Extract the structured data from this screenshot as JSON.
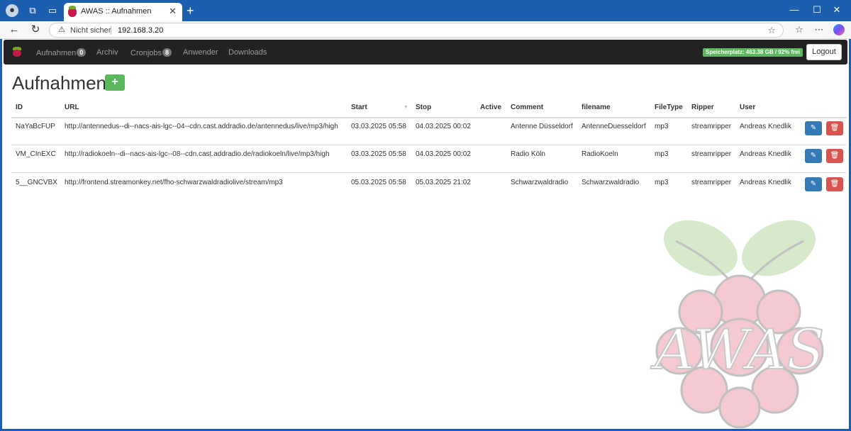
{
  "browser": {
    "tab_title": "AWAS :: Aufnahmen",
    "tab_close": "✕",
    "new_tab": "+",
    "security_label": "Nicht sicher",
    "url": "192.168.3.20",
    "win_min": "—",
    "win_max": "☐",
    "win_close": "✕"
  },
  "navbar": {
    "items": [
      {
        "label": "Aufnahmen",
        "badge": "0"
      },
      {
        "label": "Archiv"
      },
      {
        "label": "Cronjobs",
        "badge": "8"
      },
      {
        "label": "Anwender"
      },
      {
        "label": "Downloads"
      }
    ],
    "storage": "Speicherplatz: 463.38 GB / 92% frei",
    "logout": "Logout"
  },
  "main": {
    "title": "Aufnahmen",
    "add_icon": "+"
  },
  "table": {
    "columns": [
      "ID",
      "URL",
      "Start",
      "Stop",
      "Active",
      "Comment",
      "filename",
      "FileType",
      "Ripper",
      "User"
    ],
    "rows": [
      {
        "id": "NaYaBcFUP",
        "url": "http://antennedus--di--nacs-ais-lgc--04--cdn.cast.addradio.de/antennedus/live/mp3/high",
        "start": "03.03.2025 05:58",
        "stop": "04.03.2025 00:02",
        "active": "",
        "comment": "Antenne Düsseldorf",
        "filename": "AntenneDuesseldorf",
        "filetype": "mp3",
        "ripper": "streamripper",
        "user": "Andreas Knedlik"
      },
      {
        "id": "VM_CInEXC",
        "url": "http://radiokoeln--di--nacs-ais-lgc--08--cdn.cast.addradio.de/radiokoeln/live/mp3/high",
        "start": "03.03.2025 05:58",
        "stop": "04.03.2025 00:02",
        "active": "",
        "comment": "Radio Köln",
        "filename": "RadioKoeln",
        "filetype": "mp3",
        "ripper": "streamripper",
        "user": "Andreas Knedlik"
      },
      {
        "id": "5__GNCVBX",
        "url": "http://frontend.streamonkey.net/fho-schwarzwaldradiolive/stream/mp3",
        "start": "05.03.2025 05:58",
        "stop": "05.03.2025 21:02",
        "active": "",
        "comment": "Schwarzwaldradio",
        "filename": "Schwarzwaldradio",
        "filetype": "mp3",
        "ripper": "streamripper",
        "user": "Andreas Knedlik"
      }
    ]
  },
  "watermark": {
    "text": "AWAS"
  },
  "colors": {
    "navbar": "#222222",
    "success": "#5cb85c",
    "primary": "#337ab7",
    "danger": "#d9534f",
    "rpi_red": "#c51a4a",
    "rpi_green": "#75a928"
  }
}
